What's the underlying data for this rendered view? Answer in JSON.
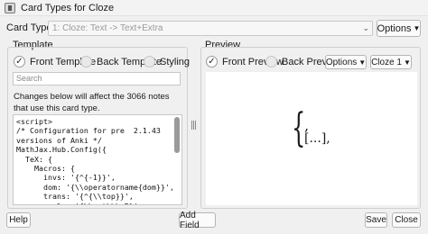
{
  "window": {
    "title": "Card Types for Cloze",
    "icon": "anki-window-icon"
  },
  "card_type": {
    "label": "Card Type:",
    "value": "1: Cloze: Text -> Text+Extra",
    "options_label": "Options"
  },
  "template": {
    "group_title": "Template",
    "radios": [
      {
        "label": "Front Template",
        "checked": true
      },
      {
        "label": "Back Template",
        "checked": false
      },
      {
        "label": "Styling",
        "checked": false
      }
    ],
    "search_placeholder": "Search",
    "notice": "Changes below will affect the 3066 notes that use this card type.",
    "code_lines": [
      "<script>",
      "/* Configuration for pre  2.1.43",
      "versions of Anki */",
      "MathJax.Hub.Config({",
      "  TeX: {",
      "    Macros: {",
      "      invs: '{^{-1}}',",
      "      dom: '{\\\\operatorname{dom}}',",
      "      trans: '{^{\\\\top}}',",
      "      reals: '{\\\\mathbb R}',"
    ]
  },
  "preview": {
    "group_title": "Preview",
    "radios": [
      {
        "label": "Front Preview",
        "checked": true
      },
      {
        "label": "Back Preview",
        "checked": false
      }
    ],
    "options_label": "Options",
    "card_select": "Cloze 1",
    "math_line1": ",",
    "math_line2": "[...],"
  },
  "buttons": {
    "help": "Help",
    "add_field": "Add Field",
    "save": "Save",
    "close": "Close"
  }
}
